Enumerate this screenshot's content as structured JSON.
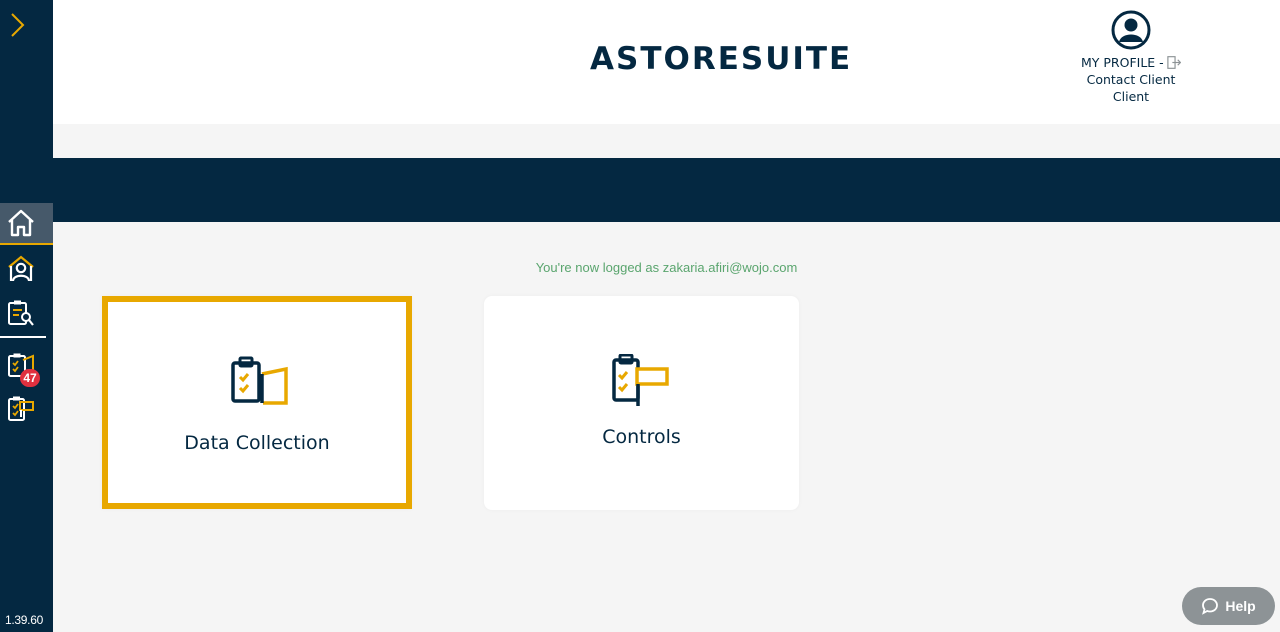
{
  "app": {
    "logo_text": "ASTORESUITE",
    "version": "1.39.60"
  },
  "sidebar": {
    "items": [
      {
        "name": "home",
        "icon": "home-icon",
        "active": true
      },
      {
        "name": "clients",
        "icon": "user-house-icon",
        "active": false
      },
      {
        "name": "audits",
        "icon": "clipboard-search-icon",
        "active": false
      },
      {
        "name": "data-collection",
        "icon": "clipboard-check-icon",
        "badge": "47"
      },
      {
        "name": "controls",
        "icon": "clipboard-flag-icon"
      }
    ]
  },
  "header": {
    "profile_label": "MY PROFILE -",
    "user_line1": "Contact Client",
    "user_line2": "Client"
  },
  "main": {
    "logged_message": "You're now logged as zakaria.afiri@wojo.com",
    "cards": [
      {
        "label": "Data Collection",
        "icon": "data-collection-icon",
        "selected": true
      },
      {
        "label": "Controls",
        "icon": "controls-icon",
        "selected": false
      }
    ]
  },
  "help": {
    "label": "Help"
  },
  "colors": {
    "navy": "#042841",
    "accent": "#e8a800",
    "success_text": "#5aa56e",
    "badge": "#e0303f"
  }
}
